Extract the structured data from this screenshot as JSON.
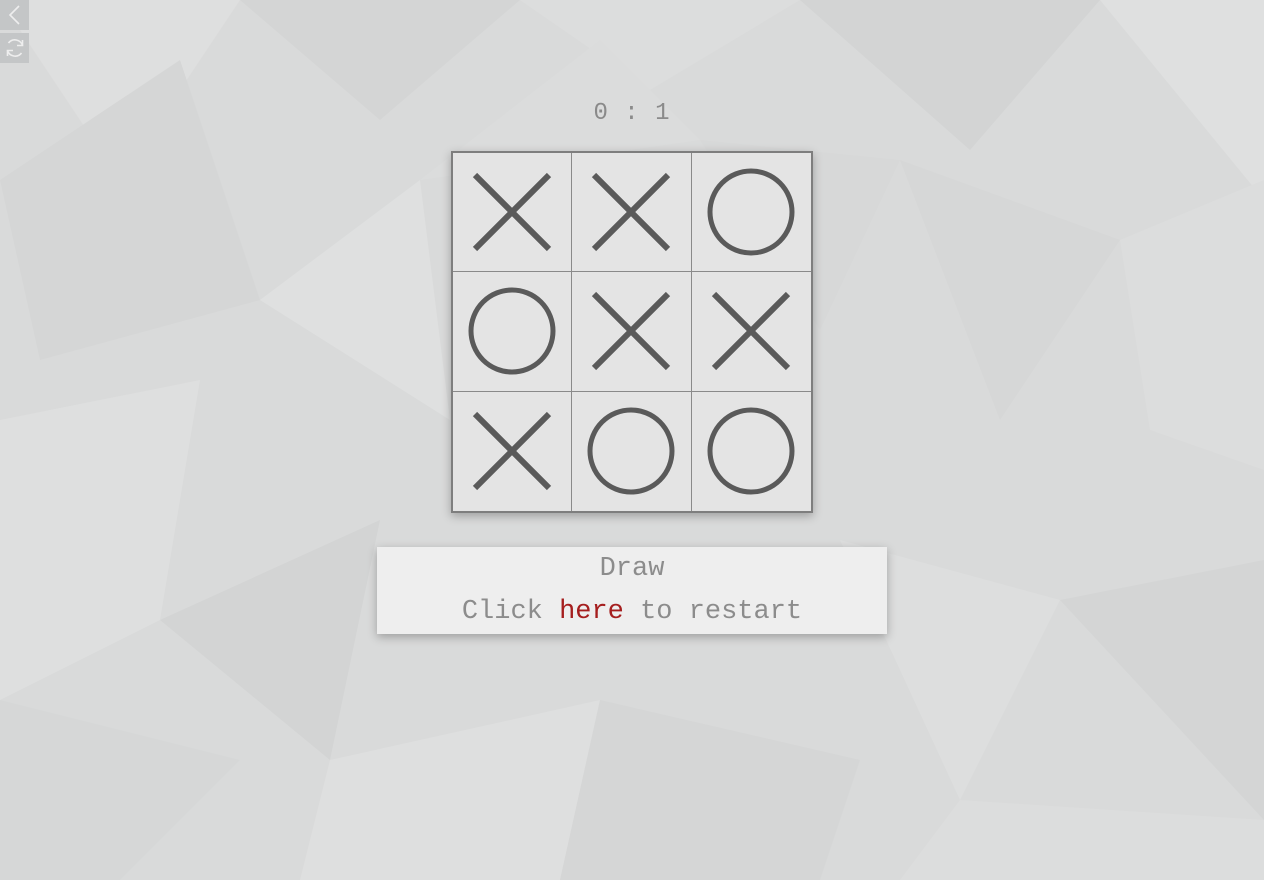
{
  "score": {
    "text": "0 : 1"
  },
  "board": {
    "cells": [
      [
        "X",
        "X",
        "O"
      ],
      [
        "O",
        "X",
        "X"
      ],
      [
        "X",
        "O",
        "O"
      ]
    ]
  },
  "result": {
    "status": "Draw",
    "restart_prefix": "Click ",
    "restart_link": "here",
    "restart_suffix": " to restart"
  },
  "icons": {
    "back": "chevron-left-icon",
    "refresh": "refresh-icon"
  },
  "colors": {
    "mark": "#5a5a5a",
    "link": "#a51e1e",
    "text": "#8c8c8c"
  }
}
